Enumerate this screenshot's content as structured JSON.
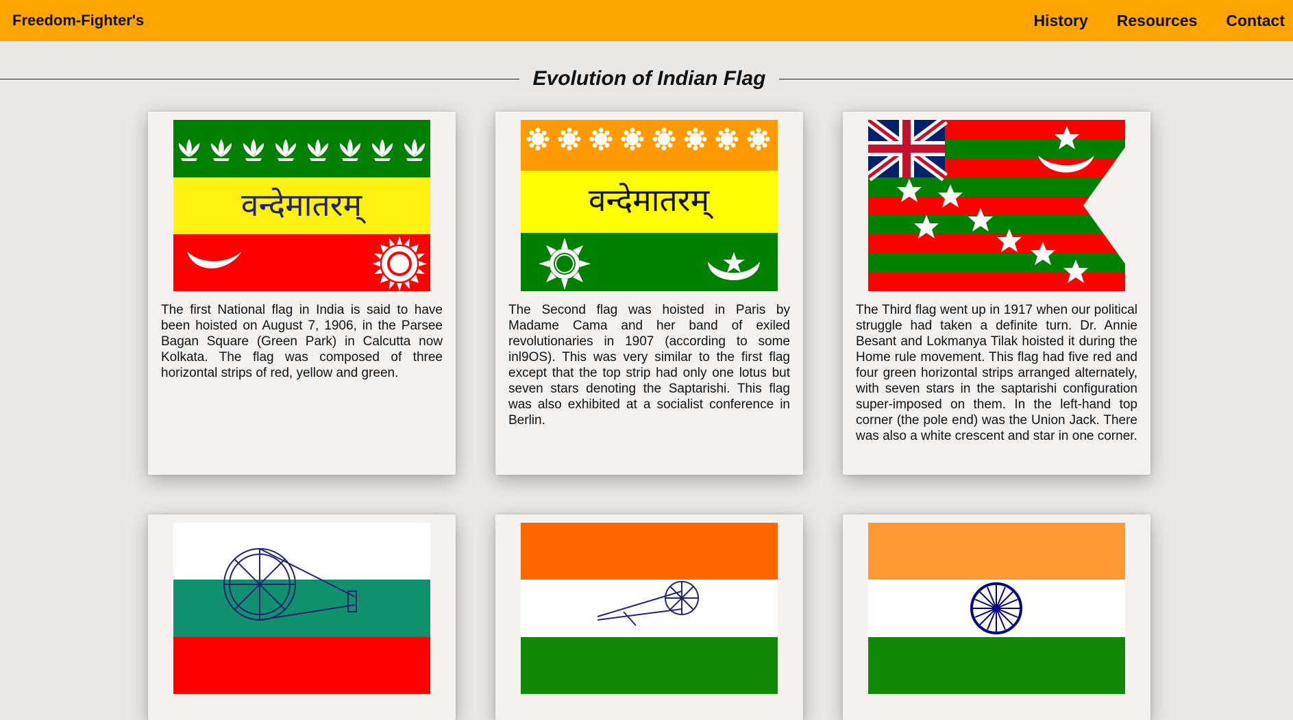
{
  "header": {
    "brand": "Freedom-Fighter's",
    "nav": [
      "History",
      "Resources",
      "Contact"
    ]
  },
  "section": {
    "title": "Evolution of Indian Flag"
  },
  "cards": [
    {
      "text": "The first National flag in India is said to have been hoisted on August 7, 1906, in the Parsee Bagan Square (Green Park) in Calcutta now Kolkata. The flag was composed of three horizontal strips of red, yellow and green.",
      "flag_text": "वन्देमातरम्"
    },
    {
      "text": "The Second flag was hoisted in Paris by Madame Cama and her band of exiled revolutionaries in 1907 (according to some inl9OS). This was very similar to the first flag except that the top strip had only one lotus but seven stars denoting the Saptarishi. This flag was also exhibited at a socialist conference in Berlin.",
      "flag_text": "वन्देमातरम्"
    },
    {
      "text": "The Third flag went up in 1917 when our political struggle had taken a definite turn. Dr. Annie Besant and Lokmanya Tilak hoisted it during the Home rule movement. This flag had five red and four green horizontal strips arranged alternately, with seven stars in the saptarishi configuration super-imposed on them. In the left-hand top corner (the pole end) was the Union Jack. There was also a white crescent and star in one corner."
    },
    {
      "text": ""
    },
    {
      "text": ""
    },
    {
      "text": ""
    }
  ],
  "colors": {
    "header": "#ffa500",
    "background": "#ebe7e4",
    "card": "#f4f1ee"
  }
}
